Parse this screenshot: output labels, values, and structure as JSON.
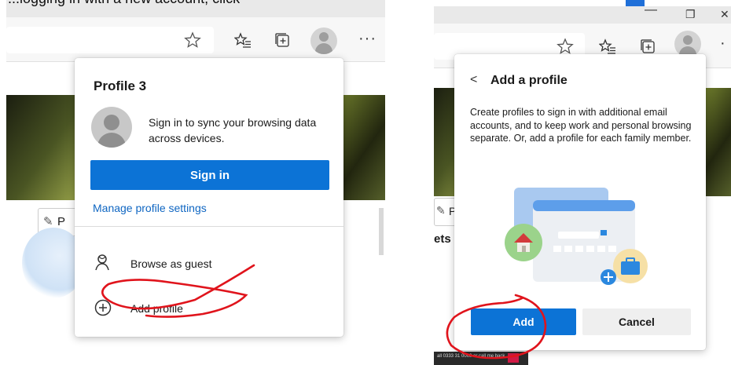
{
  "caption": "...logging in with a new account, click",
  "left_panel": {
    "menu": {
      "profile_name": "Profile 3",
      "sync_message": "Sign in to sync your browsing data across devices.",
      "sign_in_label": "Sign in",
      "manage_link": "Manage profile settings",
      "browse_guest_label": "Browse as guest",
      "add_profile_label": "Add profile"
    },
    "background_tab_fragment": "P"
  },
  "right_panel": {
    "dialog": {
      "back_glyph": "<",
      "title": "Add a profile",
      "description": "Create profiles to sign in with additional email accounts, and to keep work and personal browsing separate. Or, add a profile for each family member.",
      "add_label": "Add",
      "cancel_label": "Cancel"
    },
    "window_controls": {
      "minimize": "—",
      "restore": "❐",
      "close": "✕"
    },
    "background_tab_fragment": "P",
    "background_text_fragment": "ets",
    "footer_snippet": "all 0333 31 0000 or call me back"
  },
  "colors": {
    "accent": "#0c73d6",
    "annotation": "#e0141c"
  }
}
